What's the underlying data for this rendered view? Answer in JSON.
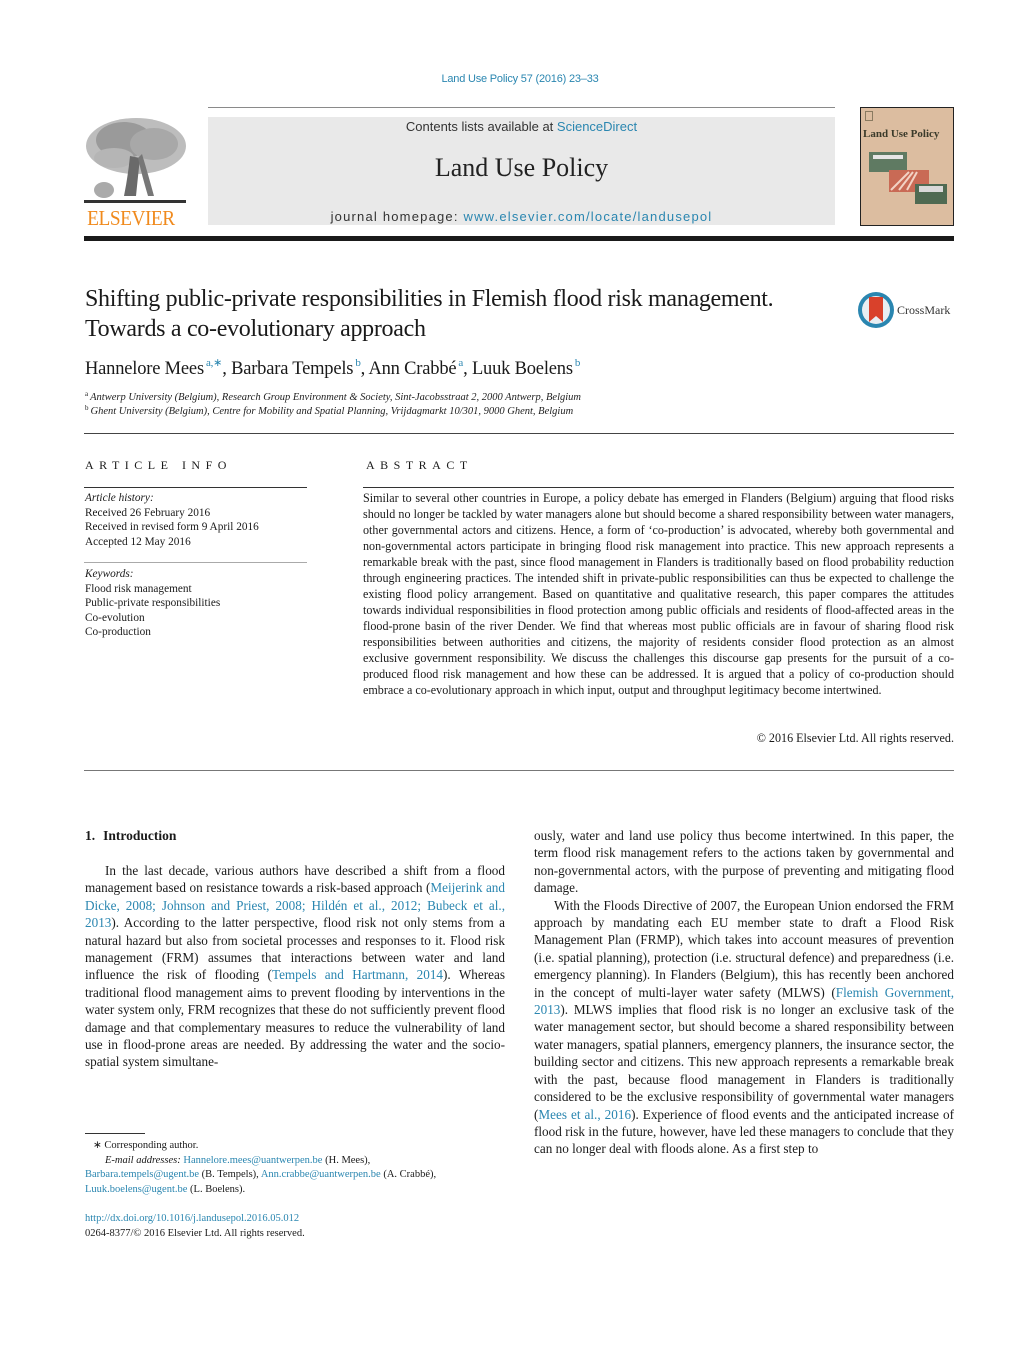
{
  "running_head": "Land Use Policy 57 (2016) 23–33",
  "publisher": {
    "name": "ELSEVIER",
    "logo_icon": "elsevier-tree-icon",
    "brand_color": "#f08a1d"
  },
  "masthead": {
    "contents_prefix": "Contents lists available at ",
    "contents_link": "ScienceDirect",
    "journal_name": "Land Use Policy",
    "homepage_prefix": "journal homepage: ",
    "homepage_link": "www.elsevier.com/locate/landusepol",
    "background_color": "#e9e9e9",
    "link_color": "#2a86b0"
  },
  "cover": {
    "title": "Land Use Policy",
    "background_color": "#dcbda0"
  },
  "article": {
    "title": "Shifting public-private responsibilities in Flemish flood risk management. Towards a co-evolutionary approach",
    "crossmark_label": "CrossMark",
    "authors": [
      {
        "name": "Hannelore Mees",
        "sup": "a,∗"
      },
      {
        "name": "Barbara Tempels",
        "sup": "b"
      },
      {
        "name": "Ann Crabbé",
        "sup": "a"
      },
      {
        "name": "Luuk Boelens",
        "sup": "b"
      }
    ],
    "affiliations": [
      {
        "key": "a",
        "text": "Antwerp University (Belgium), Research Group Environment & Society, Sint-Jacobsstraat 2, 2000 Antwerp, Belgium"
      },
      {
        "key": "b",
        "text": "Ghent University (Belgium), Centre for Mobility and Spatial Planning, Vrijdagmarkt 10/301, 9000 Ghent, Belgium"
      }
    ]
  },
  "article_info": {
    "heading": "ARTICLE INFO",
    "history_label": "Article history:",
    "history": [
      "Received 26 February 2016",
      "Received in revised form 9 April 2016",
      "Accepted 12 May 2016"
    ],
    "keywords_label": "Keywords:",
    "keywords": [
      "Flood risk management",
      "Public-private responsibilities",
      "Co-evolution",
      "Co-production"
    ]
  },
  "abstract": {
    "heading": "ABSTRACT",
    "text": "Similar to several other countries in Europe, a policy debate has emerged in Flanders (Belgium) arguing that flood risks should no longer be tackled by water managers alone but should become a shared responsibility between water managers, other governmental actors and citizens. Hence, a form of ‘co-production’ is advocated, whereby both governmental and non-governmental actors participate in bringing flood risk management into practice. This new approach represents a remarkable break with the past, since flood management in Flanders is traditionally based on flood probability reduction through engineering practices. The intended shift in private-public responsibilities can thus be expected to challenge the existing flood policy arrangement. Based on quantitative and qualitative research, this paper compares the attitudes towards individual responsibilities in flood protection among public officials and residents of flood-affected areas in the flood-prone basin of the river Dender. We find that whereas most public officials are in favour of sharing flood risk responsibilities between authorities and citizens, the majority of residents consider flood protection as an almost exclusive government responsibility. We discuss the challenges this discourse gap presents for the pursuit of a co-produced flood risk management and how these can be addressed. It is argued that a policy of co-production should embrace a co-evolutionary approach in which input, output and throughput legitimacy become intertwined.",
    "copyright": "© 2016 Elsevier Ltd. All rights reserved."
  },
  "introduction": {
    "number": "1.",
    "title": "Introduction",
    "left_para": {
      "t1": "In the last decade, various authors have described a shift from a flood management based on resistance towards a risk-based approach (",
      "cite1": "Meijerink and Dicke, 2008; Johnson and Priest, 2008; Hildén et al., 2012; Bubeck et al., 2013",
      "t2": "). According to the latter perspective, flood risk not only stems from a natural hazard but also from societal processes and responses to it. Flood risk management (FRM) assumes that interactions between water and land influence the risk of flooding (",
      "cite2": "Tempels and Hartmann, 2014",
      "t3": "). Whereas traditional flood management aims to prevent flooding by interventions in the water system only, FRM recognizes that these do not sufficiently prevent flood damage and that complementary measures to reduce the vulnerability of land use in flood-prone areas are needed. By addressing the water and the socio-spatial system simultane-"
    },
    "right_para1": "ously, water and land use policy thus become intertwined. In this paper, the term flood risk management refers to the actions taken by governmental and non-governmental actors, with the purpose of preventing and mitigating flood damage.",
    "right_para2": {
      "t1": "With the Floods Directive of 2007, the European Union endorsed the FRM approach by mandating each EU member state to draft a Flood Risk Management Plan (FRMP), which takes into account measures of prevention (i.e. spatial planning), protection (i.e. structural defence) and preparedness (i.e. emergency planning). In Flanders (Belgium), this has recently been anchored in the concept of multi-layer water safety (MLWS) (",
      "cite1": "Flemish Government, 2013",
      "t2": "). MLWS implies that flood risk is no longer an exclusive task of the water management sector, but should become a shared responsibility between water managers, spatial planners, emergency planners, the insurance sector, the building sector and citizens. This new approach represents a remarkable break with the past, because flood management in Flanders is traditionally considered to be the exclusive responsibility of governmental water managers (",
      "cite2": "Mees et al., 2016",
      "t3": "). Experience of flood events and the anticipated increase of flood risk in the future, however, have led these managers to conclude that they can no longer deal with floods alone. As a first step to"
    }
  },
  "footnotes": {
    "corresponding": "∗ Corresponding author.",
    "email_label": "E-mail addresses:",
    "emails": [
      {
        "address": "Hannelore.mees@uantwerpen.be",
        "name": " (H. Mees),"
      },
      {
        "address": "Barbara.tempels@ugent.be",
        "name": " (B. Tempels), "
      },
      {
        "address": "Ann.crabbe@uantwerpen.be",
        "name": " (A. Crabbé),"
      },
      {
        "address": "Luuk.boelens@ugent.be",
        "name": " (L. Boelens)."
      }
    ],
    "doi": "http://dx.doi.org/10.1016/j.landusepol.2016.05.012",
    "issn": "0264-8377/© 2016 Elsevier Ltd. All rights reserved."
  }
}
